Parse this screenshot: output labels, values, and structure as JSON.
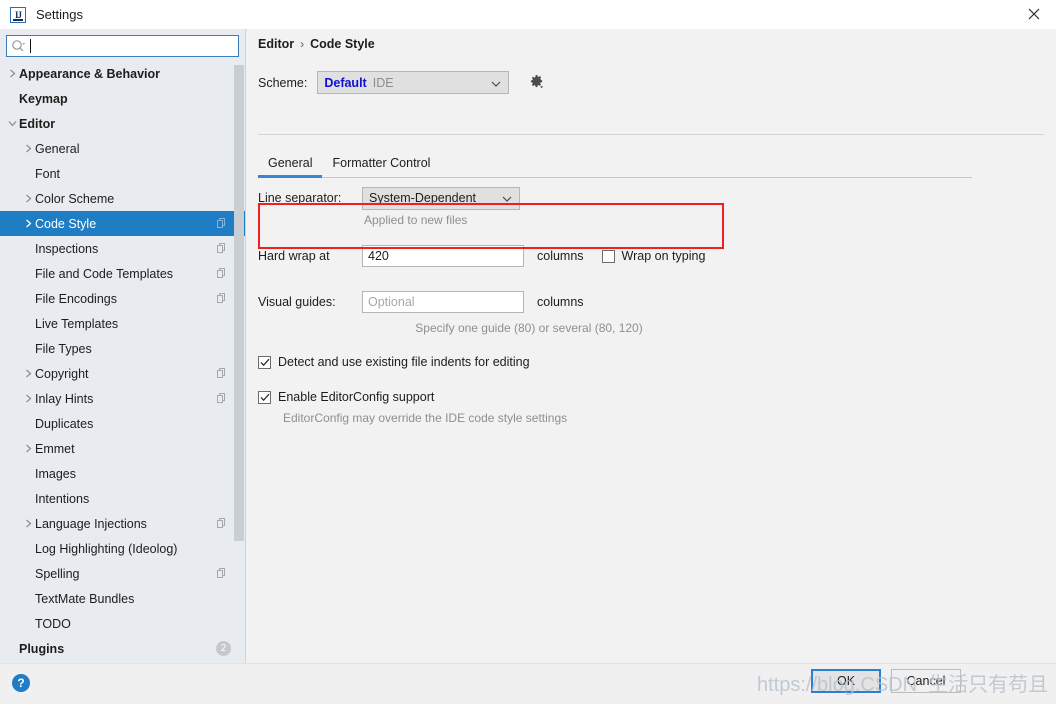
{
  "window": {
    "title": "Settings",
    "app_icon": "intellij-idea-icon",
    "close_icon": "close-icon"
  },
  "sidebar": {
    "search": {
      "placeholder": "",
      "value": "",
      "icon": "search-icon"
    },
    "items": [
      {
        "label": "Appearance & Behavior",
        "depth": 0,
        "arrow": true,
        "bold": true,
        "copy": false,
        "selected": false
      },
      {
        "label": "Keymap",
        "depth": 0,
        "arrow": false,
        "bold": true,
        "copy": false,
        "selected": false
      },
      {
        "label": "Editor",
        "depth": 0,
        "arrow": true,
        "expanded": true,
        "bold": true,
        "copy": false,
        "selected": false
      },
      {
        "label": "General",
        "depth": 1,
        "arrow": true,
        "bold": false,
        "copy": false,
        "selected": false
      },
      {
        "label": "Font",
        "depth": 1,
        "arrow": false,
        "bold": false,
        "copy": false,
        "selected": false
      },
      {
        "label": "Color Scheme",
        "depth": 1,
        "arrow": true,
        "bold": false,
        "copy": false,
        "selected": false
      },
      {
        "label": "Code Style",
        "depth": 1,
        "arrow": true,
        "bold": false,
        "copy": true,
        "selected": true
      },
      {
        "label": "Inspections",
        "depth": 1,
        "arrow": false,
        "bold": false,
        "copy": true,
        "selected": false
      },
      {
        "label": "File and Code Templates",
        "depth": 1,
        "arrow": false,
        "bold": false,
        "copy": true,
        "selected": false
      },
      {
        "label": "File Encodings",
        "depth": 1,
        "arrow": false,
        "bold": false,
        "copy": true,
        "selected": false
      },
      {
        "label": "Live Templates",
        "depth": 1,
        "arrow": false,
        "bold": false,
        "copy": false,
        "selected": false
      },
      {
        "label": "File Types",
        "depth": 1,
        "arrow": false,
        "bold": false,
        "copy": false,
        "selected": false
      },
      {
        "label": "Copyright",
        "depth": 1,
        "arrow": true,
        "bold": false,
        "copy": true,
        "selected": false
      },
      {
        "label": "Inlay Hints",
        "depth": 1,
        "arrow": true,
        "bold": false,
        "copy": true,
        "selected": false
      },
      {
        "label": "Duplicates",
        "depth": 1,
        "arrow": false,
        "bold": false,
        "copy": false,
        "selected": false
      },
      {
        "label": "Emmet",
        "depth": 1,
        "arrow": true,
        "bold": false,
        "copy": false,
        "selected": false
      },
      {
        "label": "Images",
        "depth": 1,
        "arrow": false,
        "bold": false,
        "copy": false,
        "selected": false
      },
      {
        "label": "Intentions",
        "depth": 1,
        "arrow": false,
        "bold": false,
        "copy": false,
        "selected": false
      },
      {
        "label": "Language Injections",
        "depth": 1,
        "arrow": true,
        "bold": false,
        "copy": true,
        "selected": false
      },
      {
        "label": "Log Highlighting (Ideolog)",
        "depth": 1,
        "arrow": false,
        "bold": false,
        "copy": false,
        "selected": false
      },
      {
        "label": "Spelling",
        "depth": 1,
        "arrow": false,
        "bold": false,
        "copy": true,
        "selected": false
      },
      {
        "label": "TextMate Bundles",
        "depth": 1,
        "arrow": false,
        "bold": false,
        "copy": false,
        "selected": false
      },
      {
        "label": "TODO",
        "depth": 1,
        "arrow": false,
        "bold": false,
        "copy": false,
        "selected": false
      },
      {
        "label": "Plugins",
        "depth": 0,
        "arrow": false,
        "bold": true,
        "copy": false,
        "selected": false,
        "badge": "2"
      }
    ]
  },
  "main": {
    "breadcrumb": {
      "root": "Editor",
      "separator": "›",
      "current": "Code Style"
    },
    "scheme": {
      "label": "Scheme:",
      "value": "Default",
      "scope": "IDE",
      "chevron_icon": "chevron-down-icon",
      "gear_icon": "gear-icon"
    },
    "tabs": [
      {
        "label": "General",
        "active": true
      },
      {
        "label": "Formatter Control",
        "active": false
      }
    ],
    "line_separator": {
      "label": "Line separator:",
      "value": "System-Dependent",
      "hint": "Applied to new files"
    },
    "hard_wrap": {
      "label": "Hard wrap at",
      "value": "420",
      "unit": "columns",
      "wrap_on_typing_label": "Wrap on typing",
      "wrap_on_typing_checked": false
    },
    "visual_guides": {
      "label": "Visual guides:",
      "value": "",
      "placeholder": "Optional",
      "unit": "columns",
      "hint": "Specify one guide (80) or several (80, 120)"
    },
    "detect_indents": {
      "label": "Detect and use existing file indents for editing",
      "checked": true
    },
    "editorconfig": {
      "label": "Enable EditorConfig support",
      "checked": true,
      "hint": "EditorConfig may override the IDE code style settings"
    }
  },
  "footer": {
    "help_label": "?",
    "ok_label": "OK",
    "cancel_label": "Cancel"
  },
  "overlay": {
    "watermark": "https://blog.CSDN  生活只有苟且",
    "highlight_color": "#ef2020"
  }
}
